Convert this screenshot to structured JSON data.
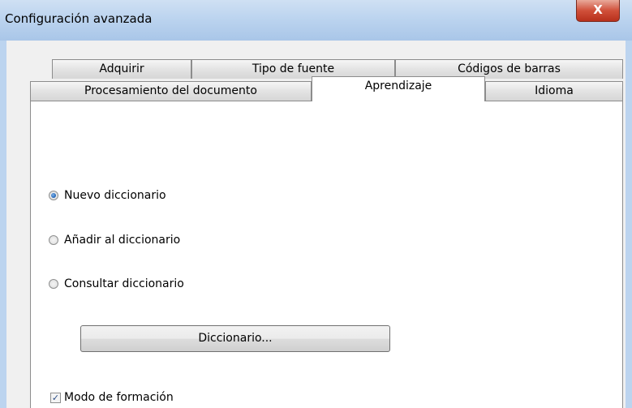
{
  "window": {
    "title": "Configuración avanzada",
    "close_glyph": "X"
  },
  "tabs_row1": [
    {
      "label": "Adquirir"
    },
    {
      "label": "Tipo de fuente"
    },
    {
      "label": "Códigos de barras"
    }
  ],
  "tabs_row2": [
    {
      "label": "Procesamiento del documento"
    },
    {
      "label": "Aprendizaje",
      "active": true
    },
    {
      "label": "Idioma"
    }
  ],
  "learning": {
    "options": [
      {
        "label": "Nuevo diccionario",
        "selected": true
      },
      {
        "label": "Añadir al diccionario",
        "selected": false
      },
      {
        "label": "Consultar diccionario",
        "selected": false
      }
    ],
    "dictionary_button": "Diccionario...",
    "training_mode": {
      "label": "Modo de formación",
      "checked": true,
      "mark": "✓"
    }
  },
  "colors": {
    "titlebar": "#bcd4ef",
    "close_button": "#c7432e",
    "radio_selected": "#1e5fb0"
  }
}
